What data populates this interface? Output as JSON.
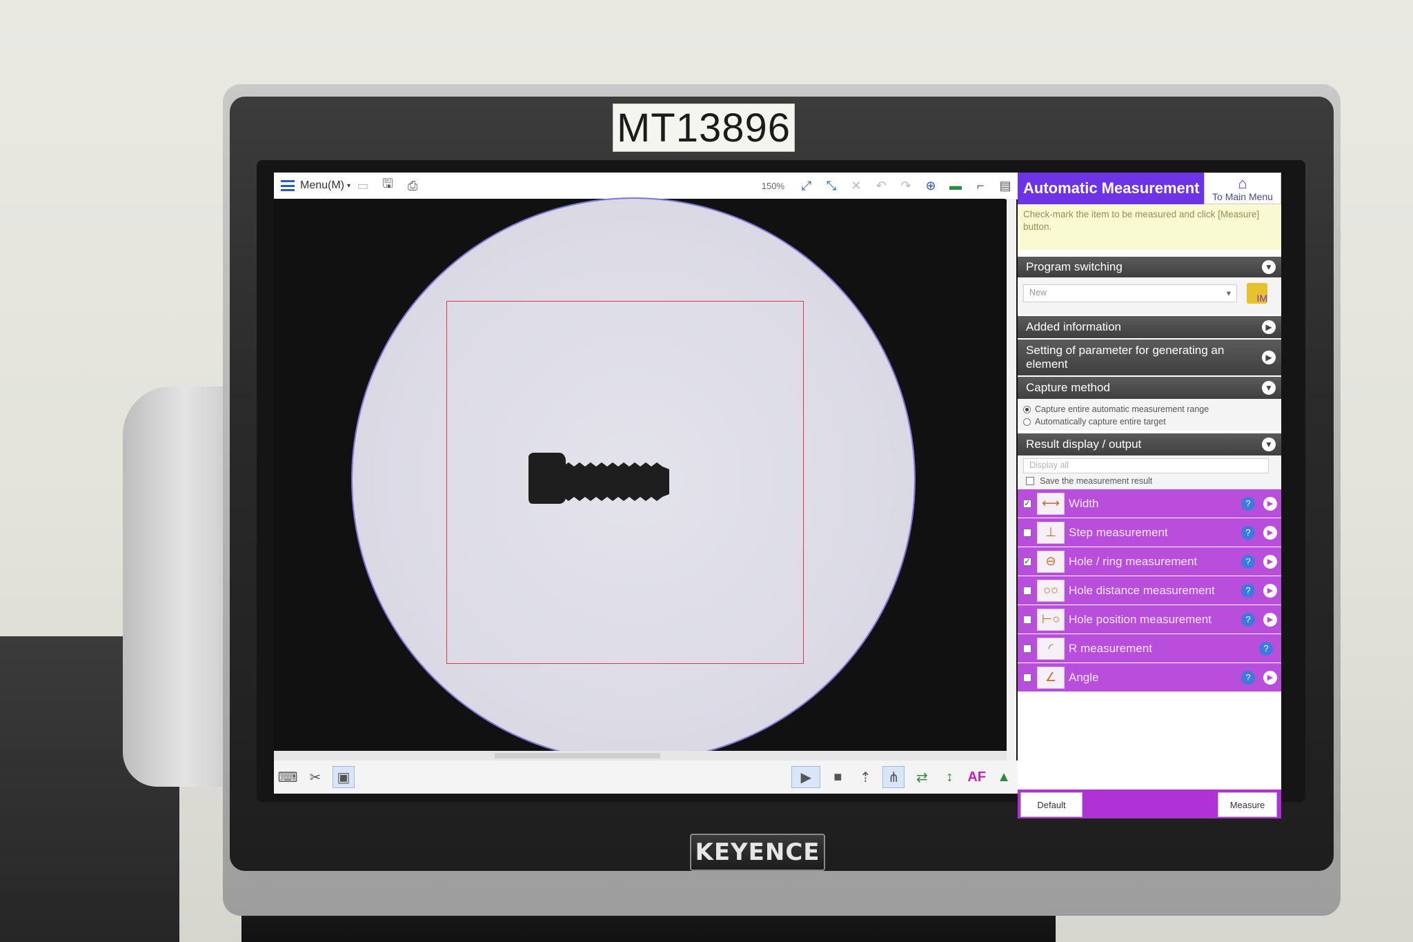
{
  "asset_label": "MT13896",
  "brand": "KEYENCE",
  "toolbar": {
    "menu_label": "Menu(M)",
    "zoom": "150%",
    "icons": [
      "save-icon",
      "save-as-icon",
      "print-icon",
      "zoom-in-icon",
      "zoom-fit-icon",
      "close-icon",
      "undo-icon",
      "redo-icon",
      "target-icon",
      "display-icon",
      "scale-icon",
      "report-icon"
    ]
  },
  "panel": {
    "title": "Automatic Measurement",
    "home_label": "To Main Menu",
    "hint": "Check-mark the item to be measured and click [Measure] button.",
    "program_switching": {
      "label": "Program switching",
      "value": "New",
      "folder_label": "IM"
    },
    "added_information": "Added information",
    "setting_parameter": "Setting of parameter for generating an element",
    "capture_method": {
      "label": "Capture method",
      "options": [
        "Capture entire automatic measurement range",
        "Automatically capture entire target"
      ],
      "selected_index": 0
    },
    "result_display": {
      "label": "Result display / output",
      "value": "Display all",
      "save_label": "Save the measurement result",
      "save_checked": false
    },
    "items": [
      {
        "label": "Width",
        "checked": true,
        "icon": "width-icon"
      },
      {
        "label": "Step measurement",
        "checked": false,
        "icon": "step-icon"
      },
      {
        "label": "Hole / ring measurement",
        "checked": true,
        "icon": "hole-ring-icon"
      },
      {
        "label": "Hole distance measurement",
        "checked": false,
        "icon": "hole-distance-icon"
      },
      {
        "label": "Hole position measurement",
        "checked": false,
        "icon": "hole-position-icon"
      },
      {
        "label": "R measurement",
        "checked": false,
        "icon": "r-icon"
      },
      {
        "label": "Angle",
        "checked": false,
        "icon": "angle-icon"
      }
    ],
    "default_label": "Default",
    "measure_label": "Measure"
  },
  "bottombar": {
    "af_label": "AF",
    "icons": [
      "keyboard-icon",
      "tools-icon",
      "image-icon",
      "play-icon",
      "stop-icon",
      "height-icon",
      "multi-icon",
      "stage-icon",
      "z-axis-icon",
      "light-icon"
    ]
  },
  "colors": {
    "accent_purple": "#6d33e6",
    "item_purple": "#b84edb",
    "roi_red": "#e03b3b",
    "scope_outline": "#7a7adf"
  }
}
